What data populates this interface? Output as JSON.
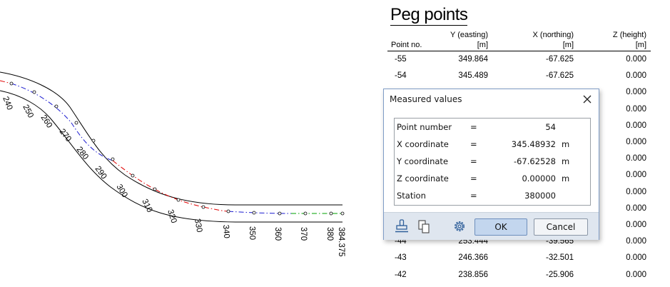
{
  "drawing": {
    "station_labels": [
      "240",
      "250",
      "260",
      "270",
      "280",
      "290",
      "300",
      "310",
      "320",
      "330",
      "340",
      "350",
      "360",
      "370",
      "380",
      "384.375"
    ]
  },
  "table": {
    "title": "Peg points",
    "headers": {
      "point_no": "Point no.",
      "y_line1": "Y (easting)",
      "y_line2": "[m]",
      "x_line1": "X (northing)",
      "x_line2": "[m]",
      "z_line1": "Z (height)",
      "z_line2": "[m]"
    },
    "rows": [
      {
        "no": "-55",
        "y": "349.864",
        "x": "-67.625",
        "z": "0.000"
      },
      {
        "no": "-54",
        "y": "345.489",
        "x": "-67.625",
        "z": "0.000"
      },
      {
        "no": "",
        "y": "",
        "x": "",
        "z": "0.000"
      },
      {
        "no": "",
        "y": "",
        "x": "",
        "z": "0.000"
      },
      {
        "no": "",
        "y": "",
        "x": "",
        "z": "0.000"
      },
      {
        "no": "",
        "y": "",
        "x": "",
        "z": "0.000"
      },
      {
        "no": "",
        "y": "",
        "x": "",
        "z": "0.000"
      },
      {
        "no": "",
        "y": "",
        "x": "",
        "z": "0.000"
      },
      {
        "no": "",
        "y": "",
        "x": "",
        "z": "0.000"
      },
      {
        "no": "",
        "y": "",
        "x": "",
        "z": "0.000"
      },
      {
        "no": "",
        "y": "",
        "x": "",
        "z": "0.000"
      },
      {
        "no": "-44",
        "y": "253.444",
        "x": "-39.565",
        "z": "0.000"
      },
      {
        "no": "-43",
        "y": "246.366",
        "x": "-32.501",
        "z": "0.000"
      },
      {
        "no": "-42",
        "y": "238.856",
        "x": "-25.906",
        "z": "0.000"
      }
    ]
  },
  "dialog": {
    "title": "Measured values",
    "rows": [
      {
        "label": "Point number",
        "eq": "=",
        "value": "54",
        "unit": ""
      },
      {
        "label": "X coordinate",
        "eq": "=",
        "value": "345.48932",
        "unit": "m"
      },
      {
        "label": "Y coordinate",
        "eq": "=",
        "value": "-67.62528",
        "unit": "m"
      },
      {
        "label": "Z coordinate",
        "eq": "=",
        "value": "0.00000",
        "unit": "m"
      },
      {
        "label": "Station",
        "eq": "=",
        "value": "380000",
        "unit": ""
      }
    ],
    "ok_label": "OK",
    "cancel_label": "Cancel",
    "icons": [
      "stamp-icon",
      "copy-icon",
      "settings-icon"
    ]
  },
  "colors": {
    "axis_red": "#e00000",
    "axis_blue": "#1a1ad0",
    "axis_green": "#00a000",
    "dialog_border": "#7f9cc6",
    "footer_bg": "#dfe6ef"
  }
}
